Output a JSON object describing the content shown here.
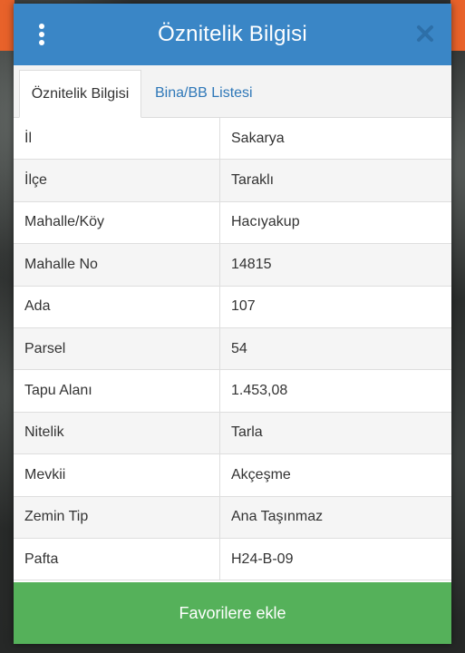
{
  "dialog": {
    "title": "Öznitelik Bilgisi",
    "icons": {
      "menu": "vertical-dots-icon",
      "close": "close-x-icon"
    },
    "colors": {
      "header": "#3a86c6",
      "footer": "#55b15a",
      "link": "#2f78b8"
    }
  },
  "tabs": [
    {
      "label": "Öznitelik Bilgisi",
      "active": true
    },
    {
      "label": "Bina/BB Listesi",
      "active": false
    }
  ],
  "attributes": [
    {
      "key": "İl",
      "value": "Sakarya"
    },
    {
      "key": "İlçe",
      "value": "Taraklı"
    },
    {
      "key": "Mahalle/Köy",
      "value": "Hacıyakup"
    },
    {
      "key": "Mahalle No",
      "value": "14815"
    },
    {
      "key": "Ada",
      "value": "107"
    },
    {
      "key": "Parsel",
      "value": "54"
    },
    {
      "key": "Tapu Alanı",
      "value": "1.453,08"
    },
    {
      "key": "Nitelik",
      "value": "Tarla"
    },
    {
      "key": "Mevkii",
      "value": "Akçeşme"
    },
    {
      "key": "Zemin Tip",
      "value": "Ana Taşınmaz"
    },
    {
      "key": "Pafta",
      "value": "H24-B-09"
    }
  ],
  "footer": {
    "button_label": "Favorilere ekle"
  }
}
